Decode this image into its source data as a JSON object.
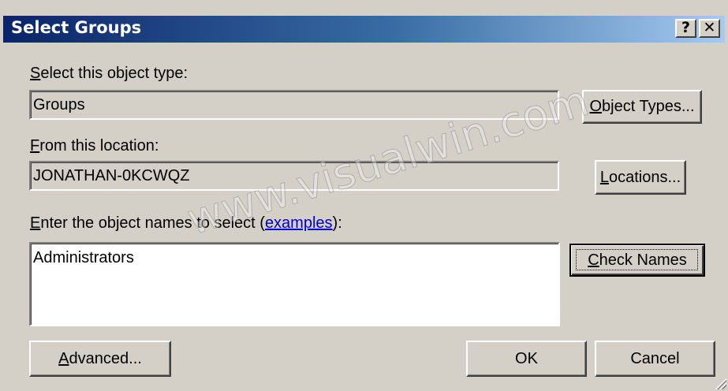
{
  "window": {
    "title": "Select Groups",
    "help_label": "?",
    "close_label": "✕"
  },
  "object_type": {
    "label_mnemonic": "S",
    "label_rest": "elect this object type:",
    "value": "Groups"
  },
  "location": {
    "label_mnemonic": "F",
    "label_rest": "rom this location:",
    "value": "JONATHAN-0KCWQZ"
  },
  "names": {
    "label_mnemonic": "E",
    "label_rest": "nter the object names to select (",
    "link_text": "examples",
    "label_suffix": "):",
    "value": "Administrators"
  },
  "buttons": {
    "object_types": {
      "mnemonic": "O",
      "rest": "bject Types..."
    },
    "locations": {
      "mnemonic": "L",
      "rest": "ocations..."
    },
    "check_names": {
      "mnemonic": "C",
      "rest": "heck Names"
    },
    "advanced": {
      "mnemonic": "A",
      "rest": "dvanced..."
    },
    "ok": "OK",
    "cancel": "Cancel"
  },
  "watermark": "www.visualwin.com"
}
